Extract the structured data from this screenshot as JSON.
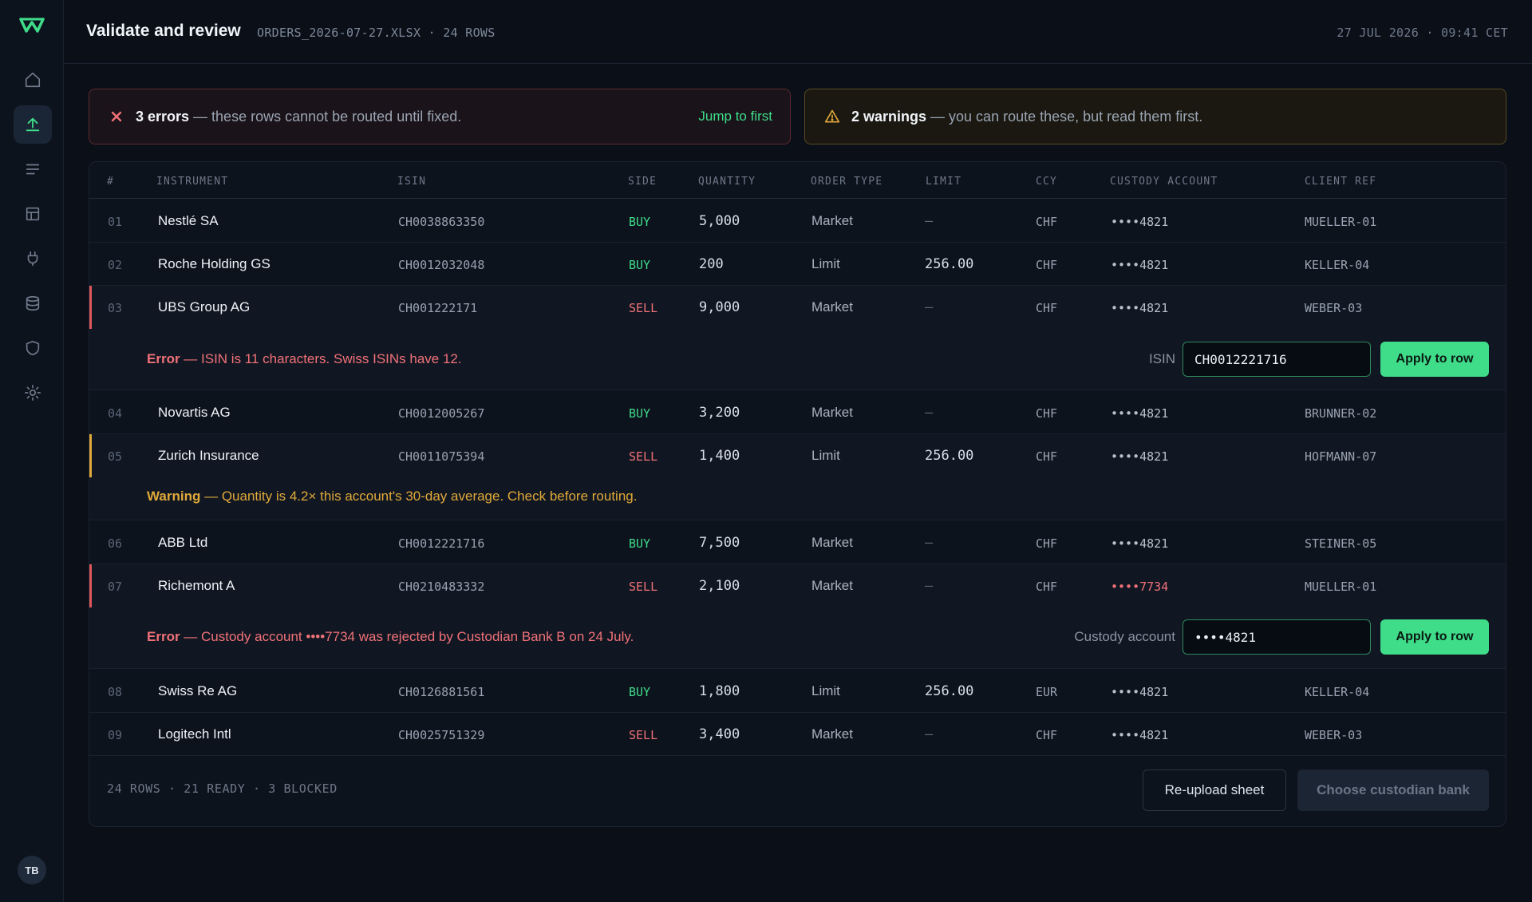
{
  "header": {
    "title": "Validate and review",
    "file_meta": "ORDERS_2026-07-27.XLSX · 24 ROWS",
    "timestamp": "27 JUL 2026 · 09:41 CET"
  },
  "sidebar": {
    "items": [
      {
        "name": "home",
        "icon": "home-icon"
      },
      {
        "name": "upload",
        "icon": "upload-icon",
        "active": true
      },
      {
        "name": "list",
        "icon": "list-icon"
      },
      {
        "name": "layout",
        "icon": "layout-icon"
      },
      {
        "name": "plug",
        "icon": "plug-icon"
      },
      {
        "name": "database",
        "icon": "database-icon"
      },
      {
        "name": "shield",
        "icon": "shield-icon"
      },
      {
        "name": "settings",
        "icon": "gear-icon"
      }
    ],
    "avatar_initials": "TB"
  },
  "alerts": {
    "error": {
      "count_text": "3 errors",
      "message": " — these rows cannot be routed until fixed.",
      "action": "Jump to first"
    },
    "warning": {
      "count_text": "2 warnings",
      "message": " — you can route these, but read them first."
    }
  },
  "table": {
    "columns": [
      "#",
      "INSTRUMENT",
      "ISIN",
      "SIDE",
      "QUANTITY",
      "ORDER TYPE",
      "LIMIT",
      "CCY",
      "CUSTODY ACCOUNT",
      "CLIENT REF"
    ],
    "rows": [
      {
        "num": "01",
        "instrument": "Nestlé SA",
        "isin": "CH0038863350",
        "side": "BUY",
        "quantity": "5,000",
        "order_type": "Market",
        "limit": "—",
        "ccy": "CHF",
        "custody": "••••4821",
        "ref": "MUELLER-01"
      },
      {
        "num": "02",
        "instrument": "Roche Holding GS",
        "isin": "CH0012032048",
        "side": "BUY",
        "quantity": "200",
        "order_type": "Limit",
        "limit": "256.00",
        "ccy": "CHF",
        "custody": "••••4821",
        "ref": "KELLER-04"
      },
      {
        "num": "03",
        "instrument": "UBS Group AG",
        "isin": "CH001222171",
        "side": "SELL",
        "quantity": "9,000",
        "order_type": "Market",
        "limit": "—",
        "ccy": "CHF",
        "custody": "••••4821",
        "ref": "WEBER-03"
      },
      {
        "num": "04",
        "instrument": "Novartis AG",
        "isin": "CH0012005267",
        "side": "BUY",
        "quantity": "3,200",
        "order_type": "Market",
        "limit": "—",
        "ccy": "CHF",
        "custody": "••••4821",
        "ref": "BRUNNER-02"
      },
      {
        "num": "05",
        "instrument": "Zurich Insurance",
        "isin": "CH0011075394",
        "side": "SELL",
        "quantity": "1,400",
        "order_type": "Limit",
        "limit": "256.00",
        "ccy": "CHF",
        "custody": "••••4821",
        "ref": "HOFMANN-07"
      },
      {
        "num": "06",
        "instrument": "ABB Ltd",
        "isin": "CH0012221716",
        "side": "BUY",
        "quantity": "7,500",
        "order_type": "Market",
        "limit": "—",
        "ccy": "CHF",
        "custody": "••••4821",
        "ref": "STEINER-05"
      },
      {
        "num": "07",
        "instrument": "Richemont A",
        "isin": "CH0210483332",
        "side": "SELL",
        "quantity": "2,100",
        "order_type": "Market",
        "limit": "—",
        "ccy": "CHF",
        "custody": "••••7734",
        "ref": "MUELLER-01"
      },
      {
        "num": "08",
        "instrument": "Swiss Re AG",
        "isin": "CH0126881561",
        "side": "BUY",
        "quantity": "1,800",
        "order_type": "Limit",
        "limit": "256.00",
        "ccy": "EUR",
        "custody": "••••4821",
        "ref": "KELLER-04"
      },
      {
        "num": "09",
        "instrument": "Logitech Intl",
        "isin": "CH0025751329",
        "side": "SELL",
        "quantity": "3,400",
        "order_type": "Market",
        "limit": "—",
        "ccy": "CHF",
        "custody": "••••4821",
        "ref": "WEBER-03"
      }
    ]
  },
  "issues": {
    "row03": {
      "label": "Error",
      "message": " — ISIN is 11 characters. Swiss ISINs have 12.",
      "field_label": "ISIN",
      "field_value": "CH0012221716",
      "action": "Apply to row"
    },
    "row05": {
      "label": "Warning",
      "message": " — Quantity is 4.2× this account's 30-day average. Check before routing."
    },
    "row07": {
      "label": "Error",
      "message": " — Custody account ••••7734 was rejected by Custodian Bank B on 24 July.",
      "field_label": "Custody account",
      "field_value": "••••4821",
      "action": "Apply to row"
    }
  },
  "footer": {
    "summary": "24 ROWS · 21 READY · 3 BLOCKED",
    "reupload": "Re-upload sheet",
    "choose_bank": "Choose custodian bank"
  },
  "colors": {
    "accent": "#3fdc8a",
    "error": "#f07178",
    "warning": "#e0a93a",
    "background": "#0a0f18"
  }
}
